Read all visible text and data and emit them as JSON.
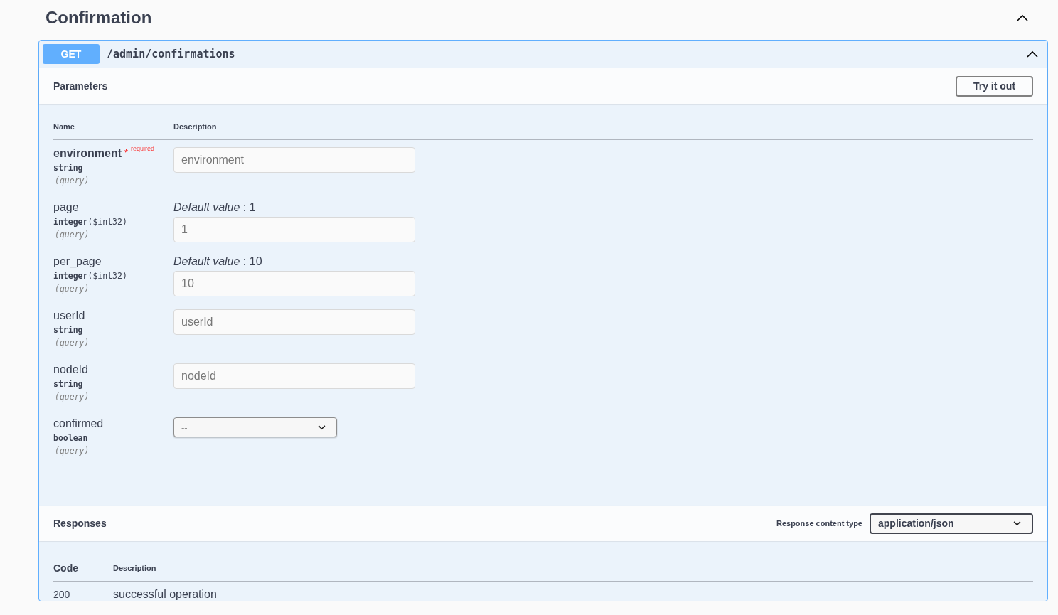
{
  "section": {
    "title": "Confirmation",
    "expanded": true
  },
  "operation": {
    "method": "GET",
    "path": "/admin/confirmations",
    "expanded": true
  },
  "parameters": {
    "title": "Parameters",
    "try_button": "Try it out",
    "columns": [
      "Name",
      "Description"
    ],
    "rows": [
      {
        "name": "environment",
        "required": true,
        "required_mark": "*",
        "required_label": "required",
        "type": "string",
        "format": "",
        "location": "(query)",
        "kind": "text",
        "placeholder": "environment"
      },
      {
        "name": "page",
        "required": false,
        "type": "integer",
        "format": "($int32)",
        "location": "(query)",
        "kind": "text",
        "default_label": "Default value",
        "default_value": " : 1",
        "placeholder": "1"
      },
      {
        "name": "per_page",
        "required": false,
        "type": "integer",
        "format": "($int32)",
        "location": "(query)",
        "kind": "text",
        "default_label": "Default value",
        "default_value": " : 10",
        "placeholder": "10"
      },
      {
        "name": "userId",
        "required": false,
        "type": "string",
        "format": "",
        "location": "(query)",
        "kind": "text",
        "placeholder": "userId"
      },
      {
        "name": "nodeId",
        "required": false,
        "type": "string",
        "format": "",
        "location": "(query)",
        "kind": "text",
        "placeholder": "nodeId"
      },
      {
        "name": "confirmed",
        "required": false,
        "type": "boolean",
        "format": "",
        "location": "(query)",
        "kind": "select",
        "value": "--"
      }
    ]
  },
  "responses": {
    "title": "Responses",
    "content_type_label": "Response content type",
    "content_type": "application/json",
    "columns": [
      "Code",
      "Description"
    ],
    "rows": [
      {
        "code": "200",
        "description": "successful operation"
      }
    ]
  }
}
